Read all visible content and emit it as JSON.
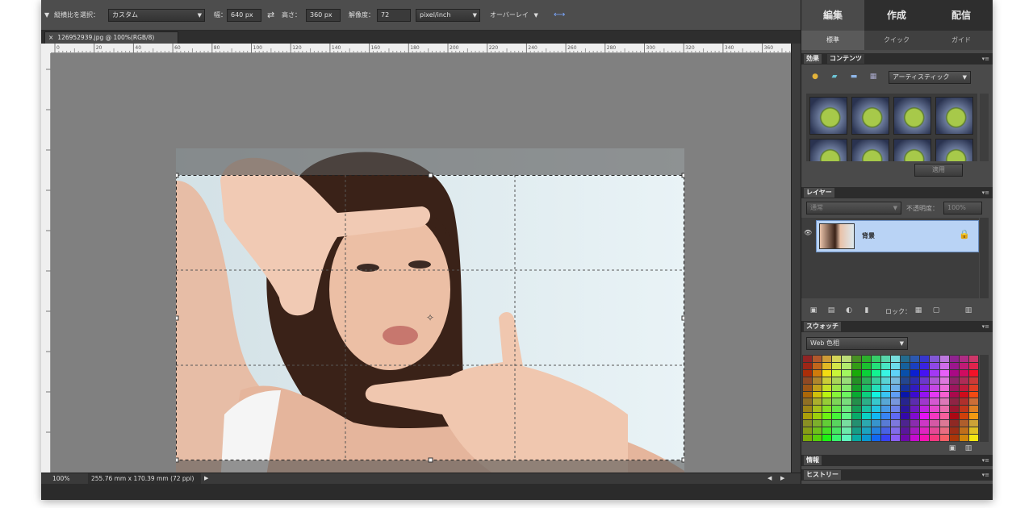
{
  "options_bar": {
    "tool_label": "縦横比を選択：",
    "ratio_value": "カスタム",
    "width_label": "幅：",
    "width_value": "640 px",
    "height_label": "高さ：",
    "height_value": "360 px",
    "resolution_label": "解像度：",
    "resolution_value": "72",
    "resolution_unit": "pixel/inch",
    "overlay_label": "オーバーレイ"
  },
  "document": {
    "tab_title": "126952939.jpg @ 100%(RGB/8)",
    "zoom": "100%",
    "doc_size": "255.76 mm x 170.39 mm (72 ppi)"
  },
  "ruler": {
    "h_ticks": [
      "0",
      "20",
      "40",
      "60",
      "80",
      "100",
      "120",
      "140",
      "160",
      "180",
      "200",
      "220",
      "240",
      "260",
      "280",
      "300",
      "320",
      "340",
      "360",
      "380"
    ]
  },
  "panel": {
    "mode_tabs": [
      "編集",
      "作成",
      "配信"
    ],
    "sub_tabs": [
      "標準",
      "クイック",
      "ガイド"
    ],
    "effects": {
      "tab1": "効果",
      "tab2": "コンテンツ",
      "category": "アーティスティック",
      "apply": "適用"
    },
    "layers": {
      "title": "レイヤー",
      "blend_mode": "通常",
      "opacity_label": "不透明度：",
      "opacity_value": "100%",
      "layer_name": "背景",
      "lock_label": "ロック："
    },
    "swatches": {
      "title": "スウォッチ",
      "set": "Web 色相"
    },
    "info": {
      "title": "情報"
    },
    "history": {
      "title": "ヒストリー"
    }
  },
  "colors": {
    "panel_bg": "#4a4a4a",
    "canvas_bg": "#808080",
    "active_layer": "#b9d3f5"
  }
}
